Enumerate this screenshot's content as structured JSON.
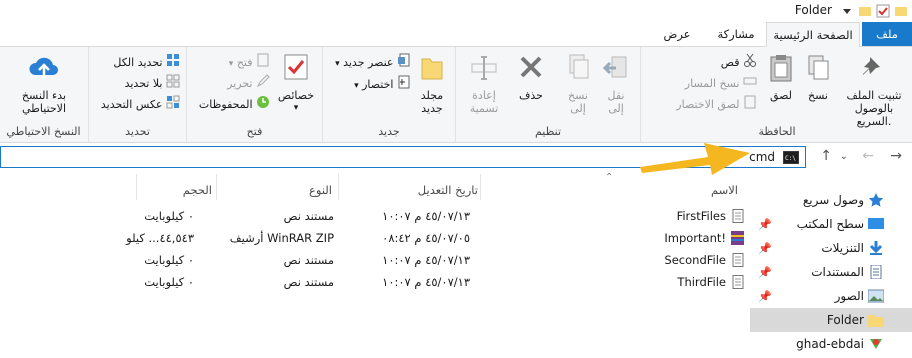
{
  "window": {
    "title": "Folder"
  },
  "tabs": {
    "file": "ملف",
    "home": "الصفحة الرئيسية",
    "share": "مشاركة",
    "view": "عرض"
  },
  "clipboard": {
    "label": "الحافظة",
    "pin": "تثبيت الملف بالوصول السريع.",
    "copy": "نسخ",
    "paste": "لصق",
    "cut": "قص",
    "copy_path": "نسخ المسار",
    "paste_shortcut": "لصق الاختصار"
  },
  "organize": {
    "label": "تنظيم",
    "move_to": "نقل إلى",
    "copy_to": "نسخ إلى",
    "delete": "حذف",
    "rename": "إعادة تسمية"
  },
  "new": {
    "label": "جديد",
    "new_folder": "مجلد جديد",
    "new_item": "عنصر جديد",
    "easy_access": "اختصار"
  },
  "open": {
    "label": "فتح",
    "properties": "خصائص",
    "open": "فتح",
    "edit": "تحرير",
    "history": "المحفوظات"
  },
  "select": {
    "label": "تحديد",
    "select_all": "تحديد الكل",
    "select_none": "بلا تحديد",
    "invert": "عكس التحديد"
  },
  "backup": {
    "label": "النسخ الاحتياطي",
    "start": "بدء النسخ الاحتياطي"
  },
  "address": {
    "text": "cmd"
  },
  "columns": {
    "name": "الاسم",
    "date": "تاريخ التعديل",
    "type": "النوع",
    "size": "الحجم"
  },
  "files": [
    {
      "name": "FirstFiles",
      "date": "٤٥/٠٧/١٣ م ١٠:٠٧",
      "type": "مستند نص",
      "size": "٠ كيلوبايت",
      "icon": "text-file-icon"
    },
    {
      "name": "Important!",
      "date": "٤٥/٠٧/٠٥ م ٠٨:٤٢",
      "type": "أرشيف WinRAR ZIP",
      "size": "٤٤,٥٤٣... كيلو",
      "icon": "winrar-icon"
    },
    {
      "name": "SecondFile",
      "date": "٤٥/٠٧/١٣ م ١٠:٠٧",
      "type": "مستند نص",
      "size": "٠ كيلوبايت",
      "icon": "text-file-icon"
    },
    {
      "name": "ThirdFile",
      "date": "٤٥/٠٧/١٣ م ١٠:٠٧",
      "type": "مستند نص",
      "size": "٠ كيلوبايت",
      "icon": "text-file-icon"
    }
  ],
  "nav": [
    {
      "label": "وصول سريع",
      "icon": "star-icon"
    },
    {
      "label": "سطح المكتب",
      "icon": "desktop-icon"
    },
    {
      "label": "التنزيلات",
      "icon": "download-icon"
    },
    {
      "label": "المستندات",
      "icon": "documents-icon"
    },
    {
      "label": "الصور",
      "icon": "pictures-icon"
    },
    {
      "label": "Folder",
      "icon": "folder-icon"
    },
    {
      "label": "ghad-ebdai",
      "icon": "app-icon"
    }
  ],
  "colors": {
    "accent": "#1979ca",
    "arrow": "#f5b71f"
  }
}
